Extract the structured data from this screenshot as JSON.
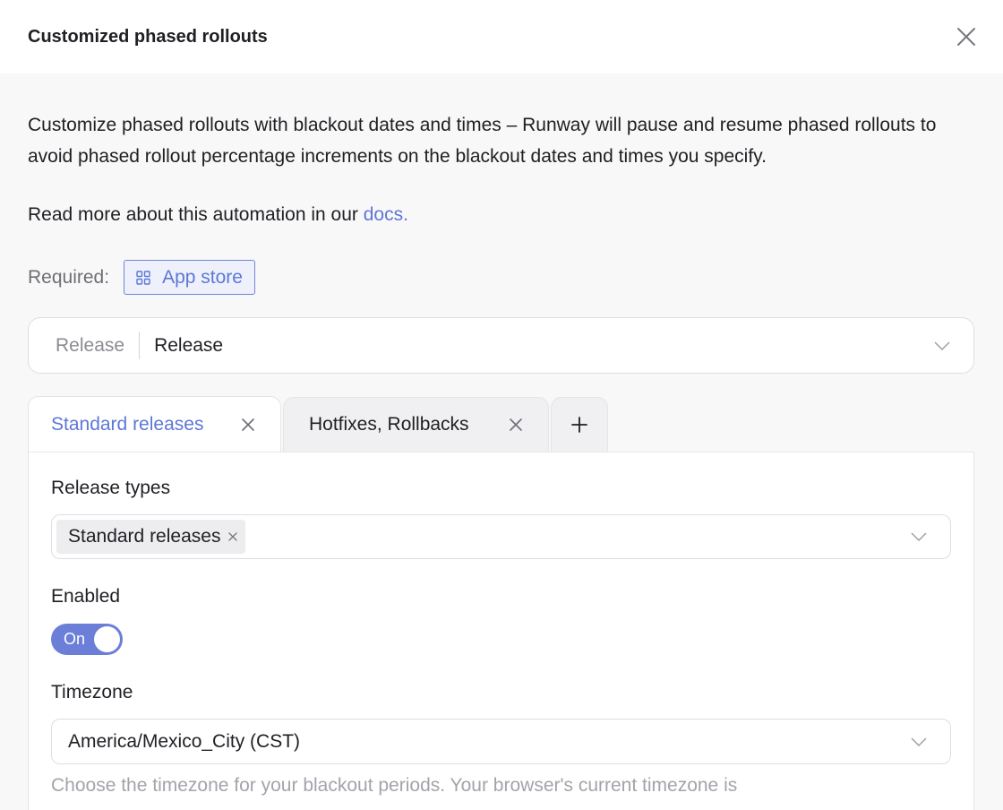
{
  "header": {
    "title": "Customized phased rollouts"
  },
  "content": {
    "description": "Customize phased rollouts with blackout dates and times – Runway will pause and resume phased rollouts to avoid phased rollout percentage increments on the blackout dates and times you specify.",
    "read_more_prefix": "Read more about this automation in our ",
    "docs_link": "docs.",
    "required_label": "Required:",
    "required_badge": "App store"
  },
  "release_select": {
    "prefix": "Release",
    "value": "Release"
  },
  "tabs": [
    {
      "label": "Standard releases",
      "active": true
    },
    {
      "label": "Hotfixes, Rollbacks",
      "active": false
    }
  ],
  "panel": {
    "release_types_label": "Release types",
    "release_types_chip": "Standard releases",
    "enabled_label": "Enabled",
    "toggle_text": "On",
    "timezone_label": "Timezone",
    "timezone_value": "America/Mexico_City (CST)",
    "timezone_helper": "Choose the timezone for your blackout periods. Your browser's current timezone is"
  },
  "colors": {
    "accent": "#5d77d6",
    "toggle_on": "#6b7fd9"
  }
}
